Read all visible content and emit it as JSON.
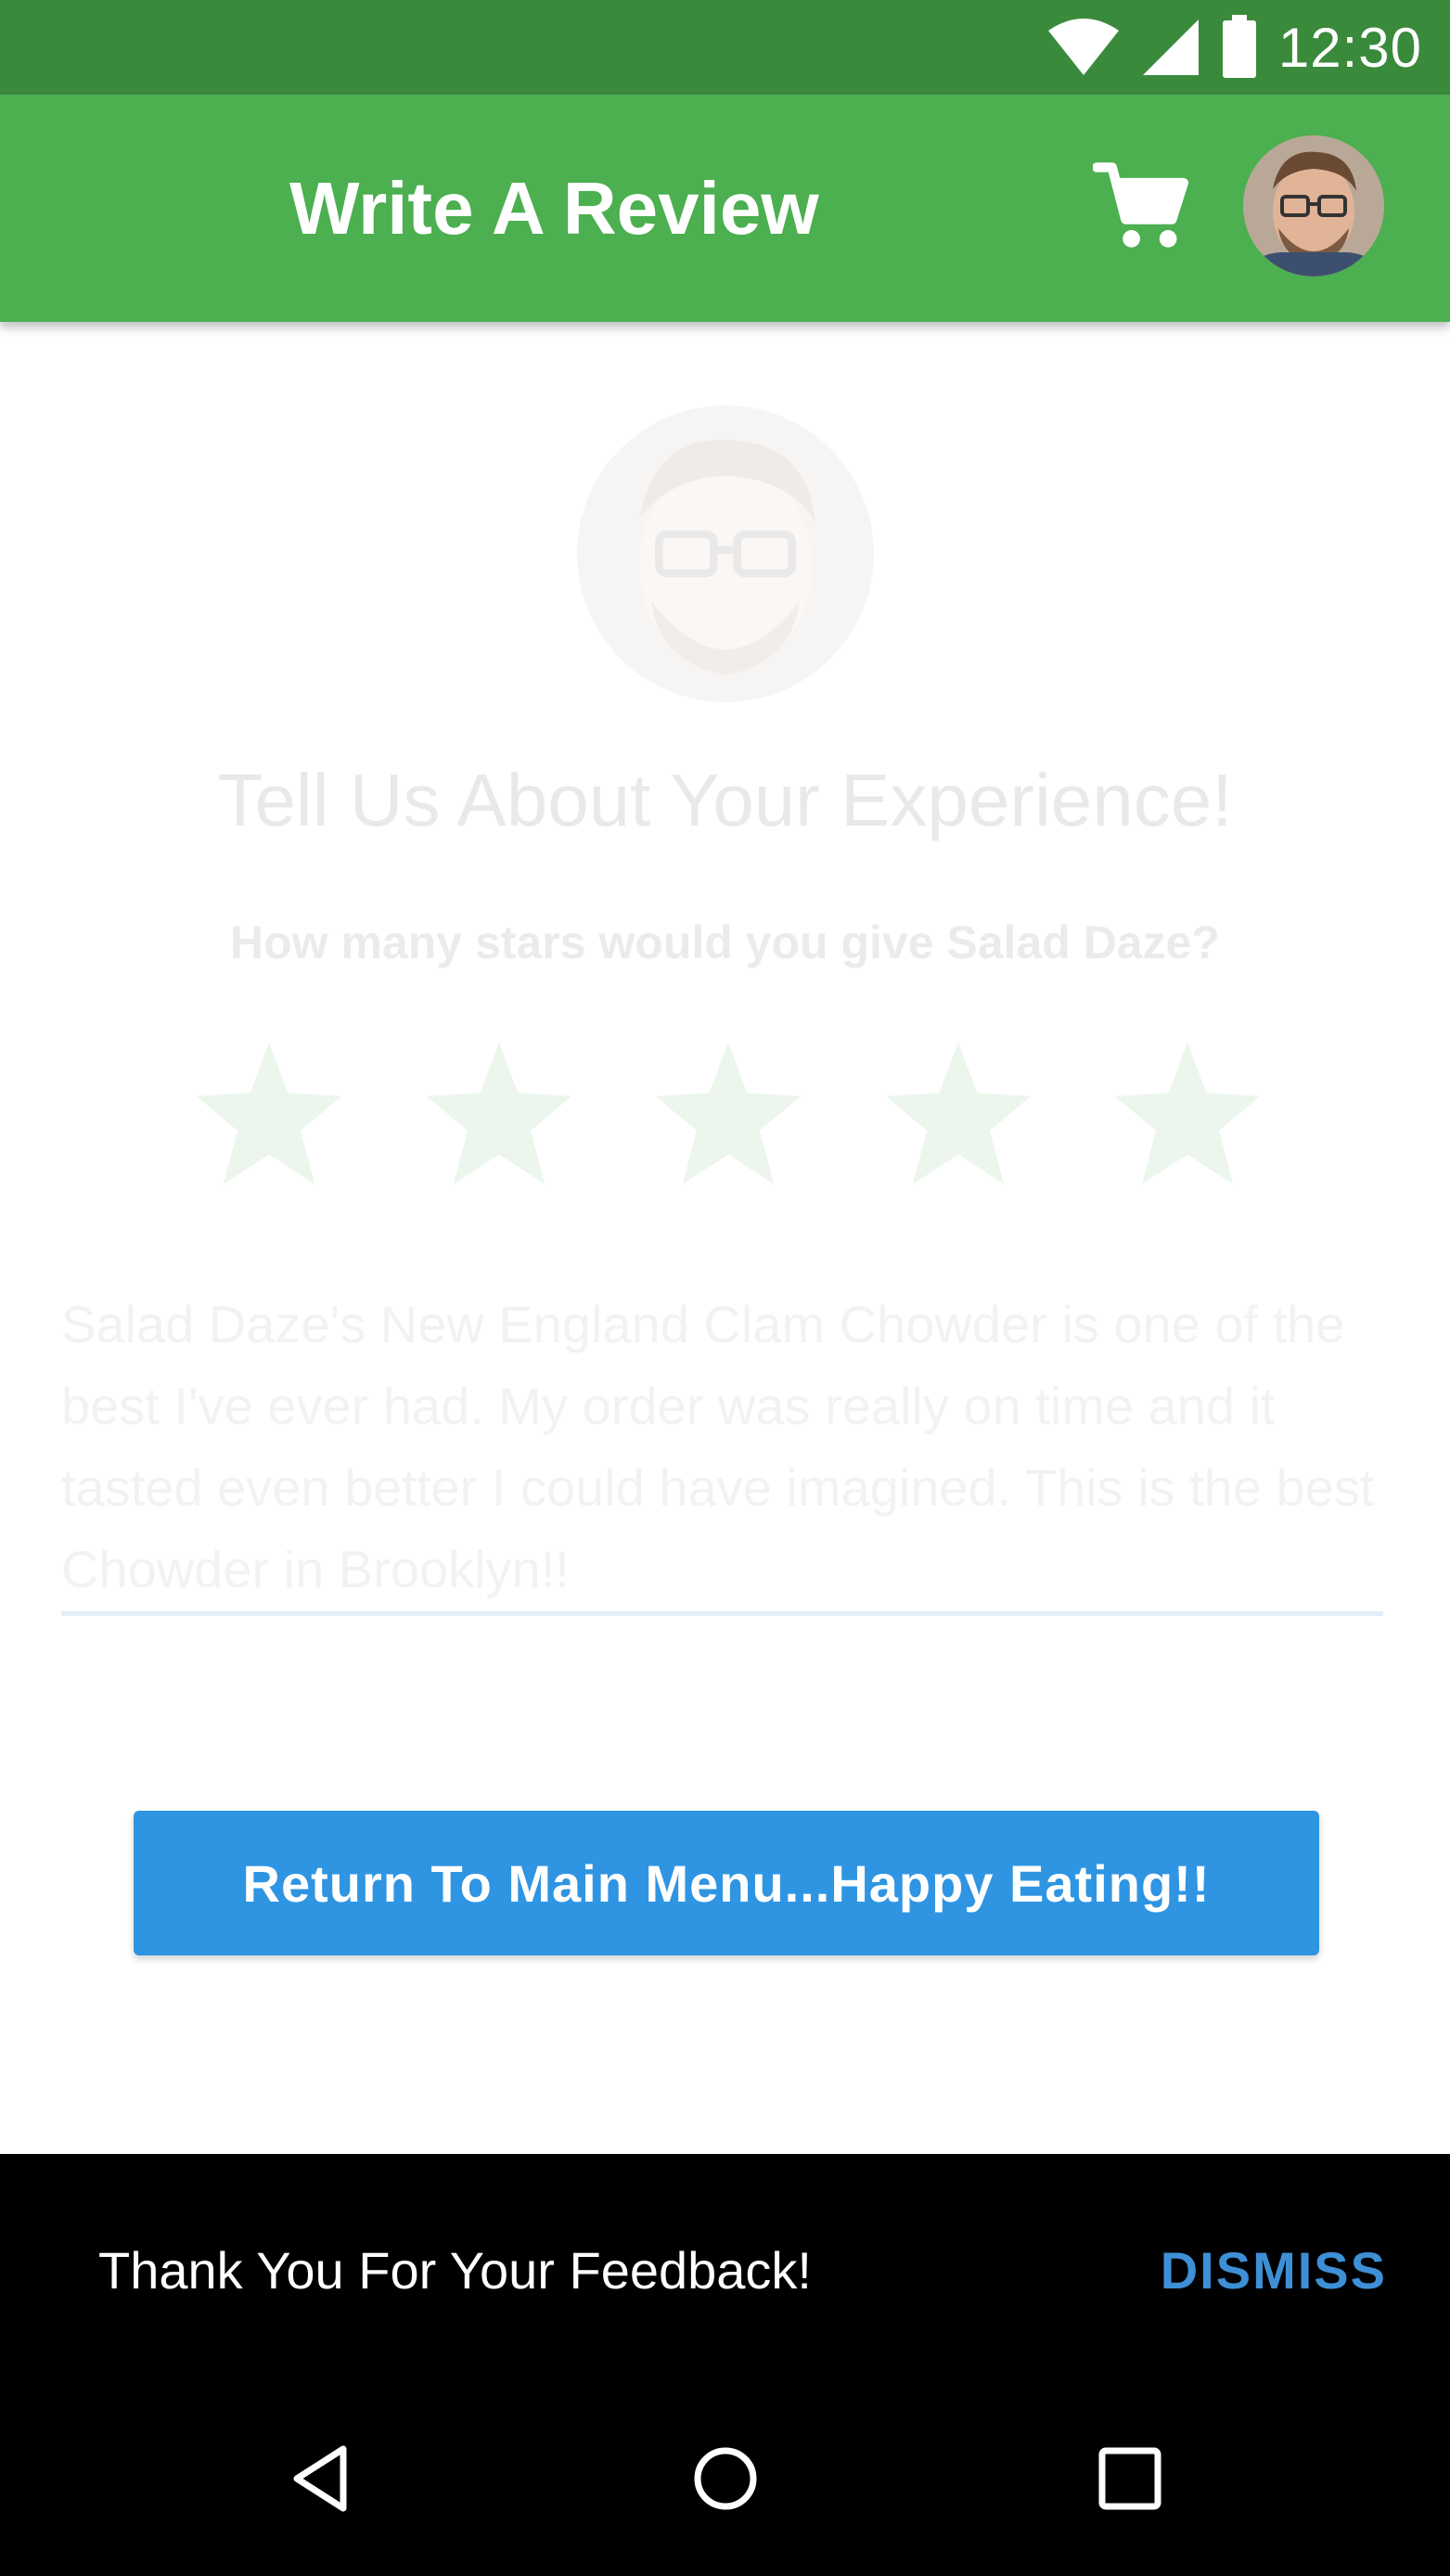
{
  "status_bar": {
    "time": "12:30",
    "icons": [
      "wifi-icon",
      "signal-icon",
      "battery-icon"
    ],
    "color": "#3a8a3c"
  },
  "app_bar": {
    "title": "Write A Review",
    "color": "#4caf50",
    "icons": [
      "cart-icon",
      "avatar"
    ]
  },
  "content": {
    "headline": "Tell Us About Your Experience!",
    "subheadline": "How many stars would you give Salad Daze?",
    "star_count": 5,
    "star_color": "#4caf50",
    "review_text": "Salad Daze's New England Clam Chowder is one of the best I've ever had. My order was really on time and it tasted even better I could have imagined. This is the best Chowder in Brooklyn!!"
  },
  "button": {
    "label": "Return To Main Menu...Happy Eating!!",
    "color": "#2f95e2"
  },
  "snackbar": {
    "message": "Thank You For Your Feedback!",
    "action": "DISMISS",
    "action_color": "#3d8fd6"
  },
  "nav_bar": {
    "icons": [
      "back-icon",
      "home-icon",
      "recents-icon"
    ]
  }
}
